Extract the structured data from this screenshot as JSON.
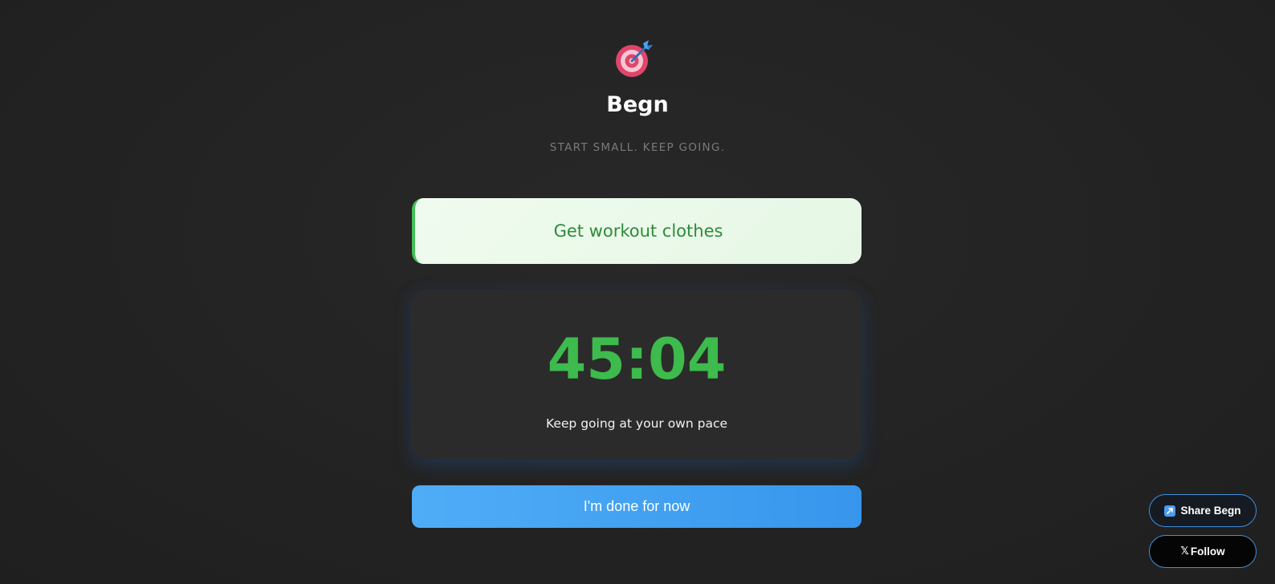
{
  "header": {
    "logo_icon": "target-dart-icon",
    "title": "Begn",
    "tagline": "START SMALL. KEEP GOING."
  },
  "task": {
    "label": "Get workout clothes"
  },
  "timer": {
    "value": "45:04",
    "caption": "Keep going at your own pace"
  },
  "actions": {
    "done_label": "I'm done for now"
  },
  "floating": {
    "share_icon": "external-link-icon",
    "share_label": "Share Begn",
    "follow_icon_glyph": "𝕏",
    "follow_label": "Follow"
  },
  "colors": {
    "accent_green": "#3dbb4c",
    "accent_blue": "#3f9ef2",
    "background": "#232323"
  }
}
